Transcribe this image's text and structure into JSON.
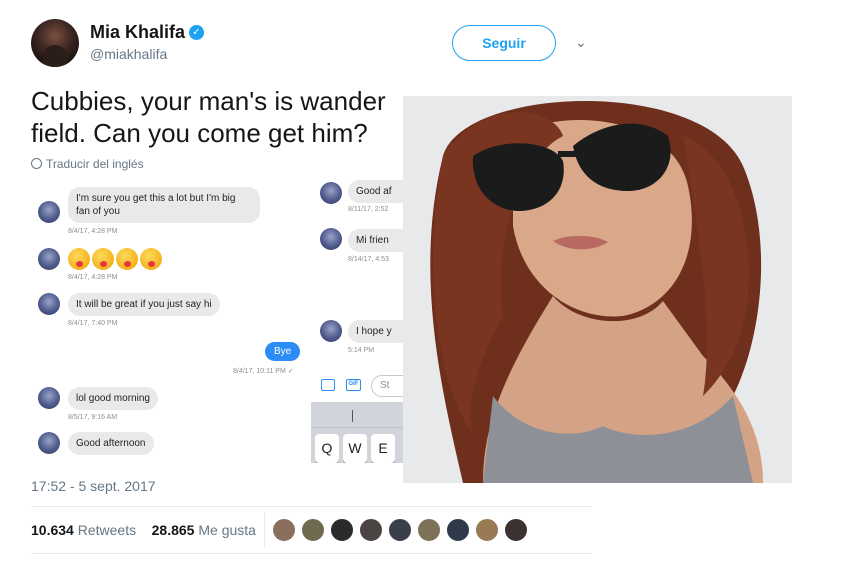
{
  "author": {
    "name": "Mia Khalifa",
    "handle": "@miakhalifa",
    "verified_mark": "✓"
  },
  "follow_button": {
    "label": "Seguir"
  },
  "menu": {
    "chevron": "⌄"
  },
  "tweet": {
    "text": "Cubbies, your man's is wander field. Can you come get him?",
    "translate_label": "Traducir del inglés"
  },
  "chat_left": {
    "messages": [
      {
        "text": "I'm sure you get this a lot but I'm big fan of you",
        "time": "8/4/17, 4:28 PM"
      },
      {
        "text": "",
        "time": "8/4/17, 4:28 PM"
      },
      {
        "text": "It will be great if you just say hi",
        "time": "8/4/17, 7:40 PM"
      },
      {
        "text": "Bye",
        "time": "8/4/17, 10:11 PM ✓"
      },
      {
        "text": "lol good morning",
        "time": "8/5/17, 9:16 AM"
      },
      {
        "text": "Good afternoon",
        "time": ""
      }
    ]
  },
  "chat_right": {
    "messages": [
      {
        "text": "Good af",
        "time": "8/11/17, 2:52"
      },
      {
        "text": "Mi frien",
        "time": "8/14/17, 4:53"
      },
      {
        "text": "I hope y",
        "time": "5:14 PM"
      }
    ],
    "compose_placeholder": "St",
    "gif_label": "GIF",
    "keys": [
      "Q",
      "W",
      "E"
    ]
  },
  "footer": {
    "timestamp": "17:52 - 5 sept. 2017",
    "retweets_count": "10.634",
    "retweets_label": "Retweets",
    "likes_count": "28.865",
    "likes_label": "Me gusta"
  },
  "colors": {
    "accent": "#1da1f2",
    "imessage_blue": "#2b8cf6",
    "text": "#14171a",
    "muted": "#657786"
  },
  "likers": [
    {
      "icon": "liker-avatar-1"
    },
    {
      "icon": "liker-avatar-2"
    },
    {
      "icon": "liker-avatar-3"
    },
    {
      "icon": "liker-avatar-4"
    },
    {
      "icon": "liker-avatar-5"
    },
    {
      "icon": "liker-avatar-6"
    },
    {
      "icon": "liker-avatar-7"
    },
    {
      "icon": "liker-avatar-8"
    },
    {
      "icon": "liker-avatar-9"
    }
  ]
}
